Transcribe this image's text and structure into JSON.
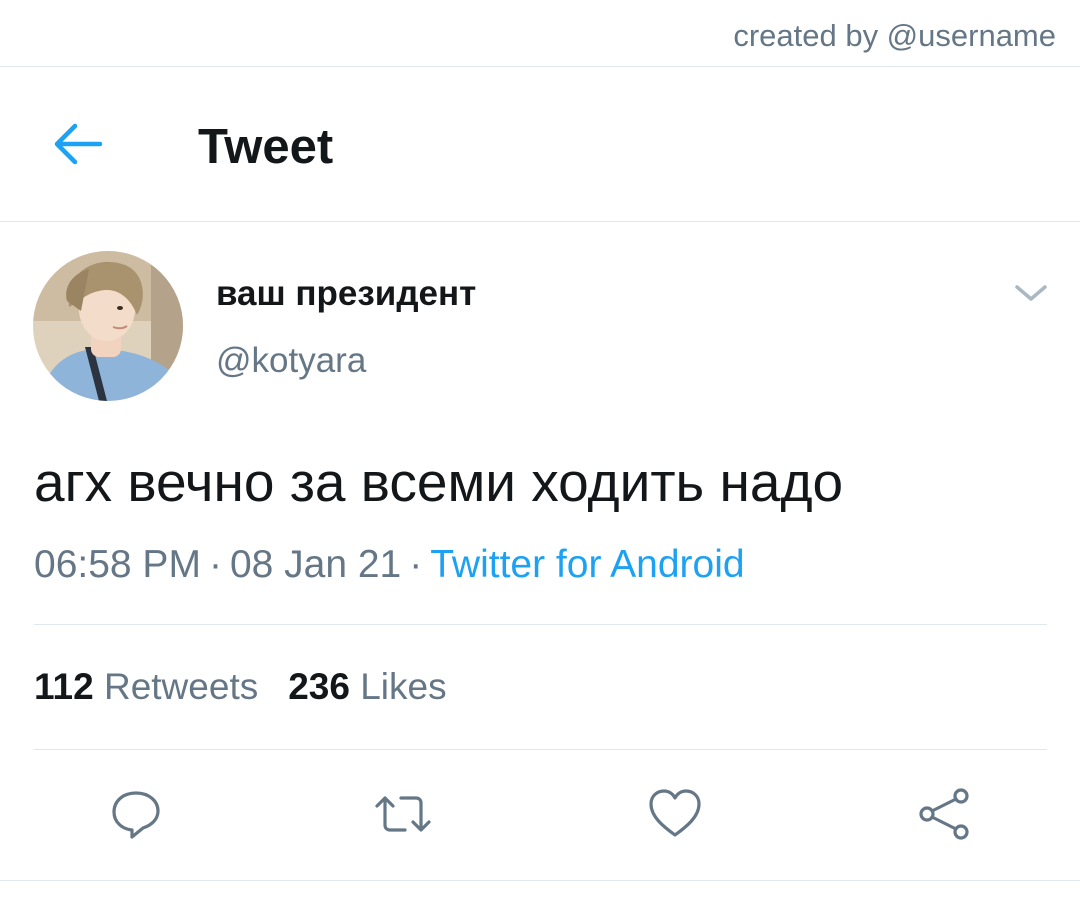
{
  "credit": "created by @username",
  "header": {
    "title": "Tweet",
    "back_icon": "arrow-left-icon",
    "accent": "#1da1f2"
  },
  "tweet": {
    "display_name": "ваш президент",
    "handle": "@kotyara",
    "text": "агх вечно за всеми ходить надо",
    "time": "06:58 PM",
    "date": "08 Jan 21",
    "separator": "·",
    "source": "Twitter for Android",
    "menu_icon": "chevron-down-icon"
  },
  "stats": {
    "retweets_count": "112",
    "retweets_label": "Retweets",
    "likes_count": "236",
    "likes_label": "Likes"
  },
  "actions": [
    "reply-icon",
    "retweet-icon",
    "like-icon",
    "share-icon"
  ],
  "colors": {
    "text": "#14171a",
    "secondary": "#657786",
    "divider": "#e1e8ed",
    "link": "#1da1f2"
  }
}
